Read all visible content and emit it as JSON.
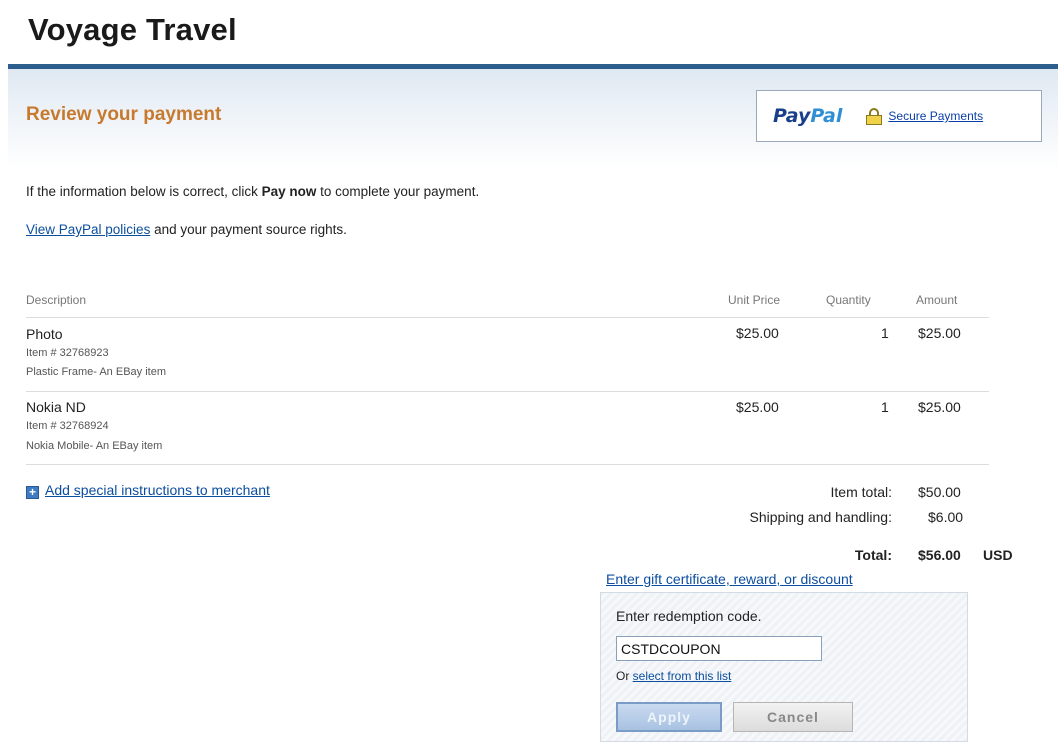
{
  "site": {
    "title": "Voyage Travel"
  },
  "header": {
    "heading": "Review your payment",
    "paypal_part1": "Pay",
    "paypal_part2": "Pal",
    "secure_link": "Secure Payments"
  },
  "intro": {
    "before": "If the information below is correct, click ",
    "bold": "Pay now",
    "after": " to complete your payment."
  },
  "policies": {
    "link": "View PayPal policies",
    "after": " and your payment source rights."
  },
  "table": {
    "headers": {
      "description": "Description",
      "unit_price": "Unit Price",
      "quantity": "Quantity",
      "amount": "Amount"
    },
    "items": [
      {
        "name": "Photo",
        "item_no": "Item # 32768923",
        "desc": "Plastic Frame- An EBay item",
        "unit_price": "$25.00",
        "quantity": "1",
        "amount": "$25.00"
      },
      {
        "name": "Nokia ND",
        "item_no": "Item # 32768924",
        "desc": "Nokia Mobile- An EBay item",
        "unit_price": "$25.00",
        "quantity": "1",
        "amount": "$25.00"
      }
    ]
  },
  "instructions": {
    "icon": "plus-icon",
    "link": "Add special instructions to merchant"
  },
  "summary": {
    "item_total_label": "Item total:",
    "item_total": "$50.00",
    "shipping_label": "Shipping and handling:",
    "shipping": "$6.00",
    "total_label": "Total:",
    "total": "$56.00",
    "currency": "USD"
  },
  "gift": {
    "link": "Enter gift certificate, reward, or discount"
  },
  "redemption": {
    "title": "Enter redemption code.",
    "code_value": "CSTDCOUPON",
    "or_text": "Or ",
    "select_link": "select from this list",
    "apply_label": "Apply",
    "cancel_label": "Cancel"
  },
  "colors": {
    "accent_rule": "#2c5e8d",
    "heading": "#c77a2e",
    "link": "#0b4d9e"
  }
}
